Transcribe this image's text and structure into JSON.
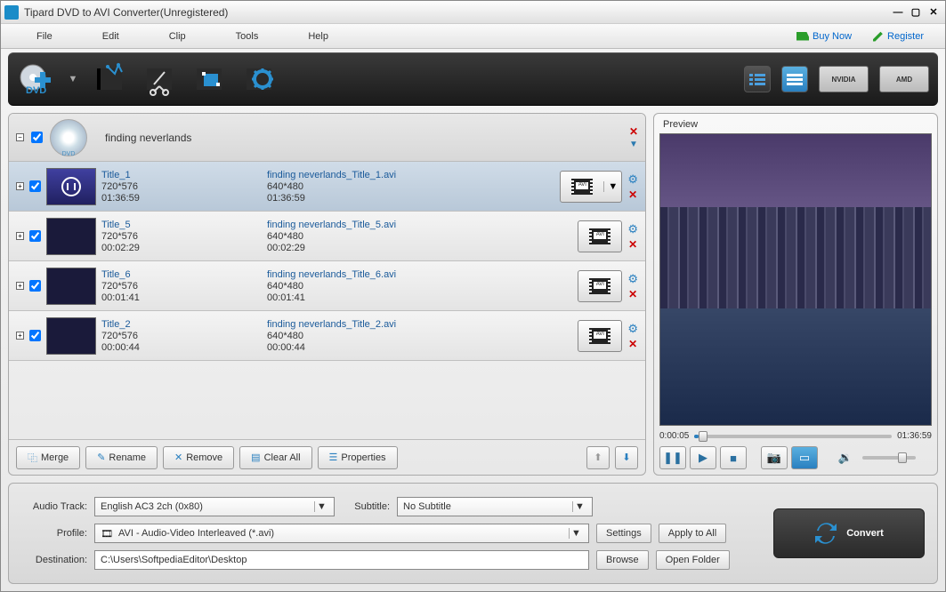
{
  "window": {
    "title": "Tipard DVD to AVI Converter(Unregistered)"
  },
  "menu": {
    "file": "File",
    "edit": "Edit",
    "clip": "Clip",
    "tools": "Tools",
    "help": "Help",
    "buy": "Buy Now",
    "register": "Register"
  },
  "gpu": {
    "nvidia": "NVIDIA",
    "amd": "AMD"
  },
  "disc": {
    "name": "finding neverlands"
  },
  "titles": [
    {
      "name": "Title_1",
      "res": "720*576",
      "dur": "01:36:59",
      "out": "finding neverlands_Title_1.avi",
      "outres": "640*480",
      "outdur": "01:36:59",
      "selected": true,
      "dd": true,
      "thumb": "play"
    },
    {
      "name": "Title_5",
      "res": "720*576",
      "dur": "00:02:29",
      "out": "finding neverlands_Title_5.avi",
      "outres": "640*480",
      "outdur": "00:02:29",
      "selected": false,
      "dd": false,
      "thumb": "dark"
    },
    {
      "name": "Title_6",
      "res": "720*576",
      "dur": "00:01:41",
      "out": "finding neverlands_Title_6.avi",
      "outres": "640*480",
      "outdur": "00:01:41",
      "selected": false,
      "dd": false,
      "thumb": "dark"
    },
    {
      "name": "Title_2",
      "res": "720*576",
      "dur": "00:00:44",
      "out": "finding neverlands_Title_2.avi",
      "outres": "640*480",
      "outdur": "00:00:44",
      "selected": false,
      "dd": false,
      "thumb": "dark"
    }
  ],
  "listbtns": {
    "merge": "Merge",
    "rename": "Rename",
    "remove": "Remove",
    "clearall": "Clear All",
    "properties": "Properties"
  },
  "preview": {
    "label": "Preview",
    "cur": "0:00:05",
    "total": "01:36:59"
  },
  "form": {
    "audioTrackLabel": "Audio Track:",
    "audioTrack": "English AC3 2ch (0x80)",
    "subtitleLabel": "Subtitle:",
    "subtitle": "No Subtitle",
    "profileLabel": "Profile:",
    "profile": "AVI - Audio-Video Interleaved (*.avi)",
    "settings": "Settings",
    "applyAll": "Apply to All",
    "destLabel": "Destination:",
    "dest": "C:\\Users\\SoftpediaEditor\\Desktop",
    "browse": "Browse",
    "openFolder": "Open Folder"
  },
  "convert": "Convert"
}
